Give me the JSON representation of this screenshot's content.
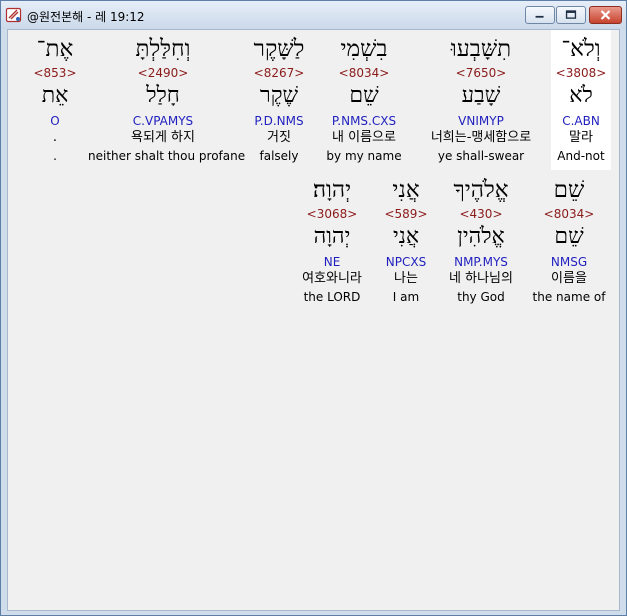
{
  "window": {
    "title": "@원전본해 - 레 19:12",
    "icon": "book-icon",
    "buttons": [
      "minimize",
      "maximize",
      "close"
    ]
  },
  "colors": {
    "strong": "#8b1a1a",
    "parse": "#1f1fbf",
    "selected_bg": "#ffffff"
  },
  "rows": [
    {
      "words": [
        {
          "hebrew": "אֶת־",
          "strong": "<853>",
          "lemma": "אֵת",
          "parse": "O",
          "korean": ".",
          "english": "."
        },
        {
          "hebrew": "וְחִלַּלְתָּ",
          "strong": "<2490>",
          "lemma": "חָלַל",
          "parse": "C.VPAMYS",
          "korean": "욕되게 하지",
          "english": "neither shalt thou profane"
        },
        {
          "hebrew": "לַשָּׁקֶר",
          "strong": "<8267>",
          "lemma": "שֶׁקֶר",
          "parse": "P.D.NMS",
          "korean": "거짓",
          "english": "falsely"
        },
        {
          "hebrew": "בִשְׁמִי",
          "strong": "<8034>",
          "lemma": "שֵׁם",
          "parse": "P.NMS.CXS",
          "korean": "내 이름으로",
          "english": "by my name"
        },
        {
          "hebrew": "תִשָּׁבְעוּ",
          "strong": "<7650>",
          "lemma": "שָׁבַע",
          "parse": "VNIMYP",
          "korean": "너희는-맹세함으로",
          "english": "ye shall-swear"
        },
        {
          "hebrew": "וְלֹא־",
          "strong": "<3808>",
          "lemma": "לֹא",
          "parse": "C.ABN",
          "korean": "말라",
          "english": "And-not"
        }
      ]
    },
    {
      "words": [
        {
          "hebrew": "יְהוָה׃",
          "strong": "<3068>",
          "lemma": "יְהוָה",
          "parse": "NE",
          "korean": "여호와니라",
          "english": "the LORD"
        },
        {
          "hebrew": "אֲנִי",
          "strong": "<589>",
          "lemma": "אֲנִי",
          "parse": "NPCXS",
          "korean": "나는",
          "english": "I am"
        },
        {
          "hebrew": "אֱלֹהֶיךָ",
          "strong": "<430>",
          "lemma": "אֱלֹהִין",
          "parse": "NMP.MYS",
          "korean": "네 하나님의",
          "english": "thy God"
        },
        {
          "hebrew": "שֵׁם",
          "strong": "<8034>",
          "lemma": "שֵׁם",
          "parse": "NMSG",
          "korean": "이름을",
          "english": "the name of"
        }
      ]
    }
  ]
}
